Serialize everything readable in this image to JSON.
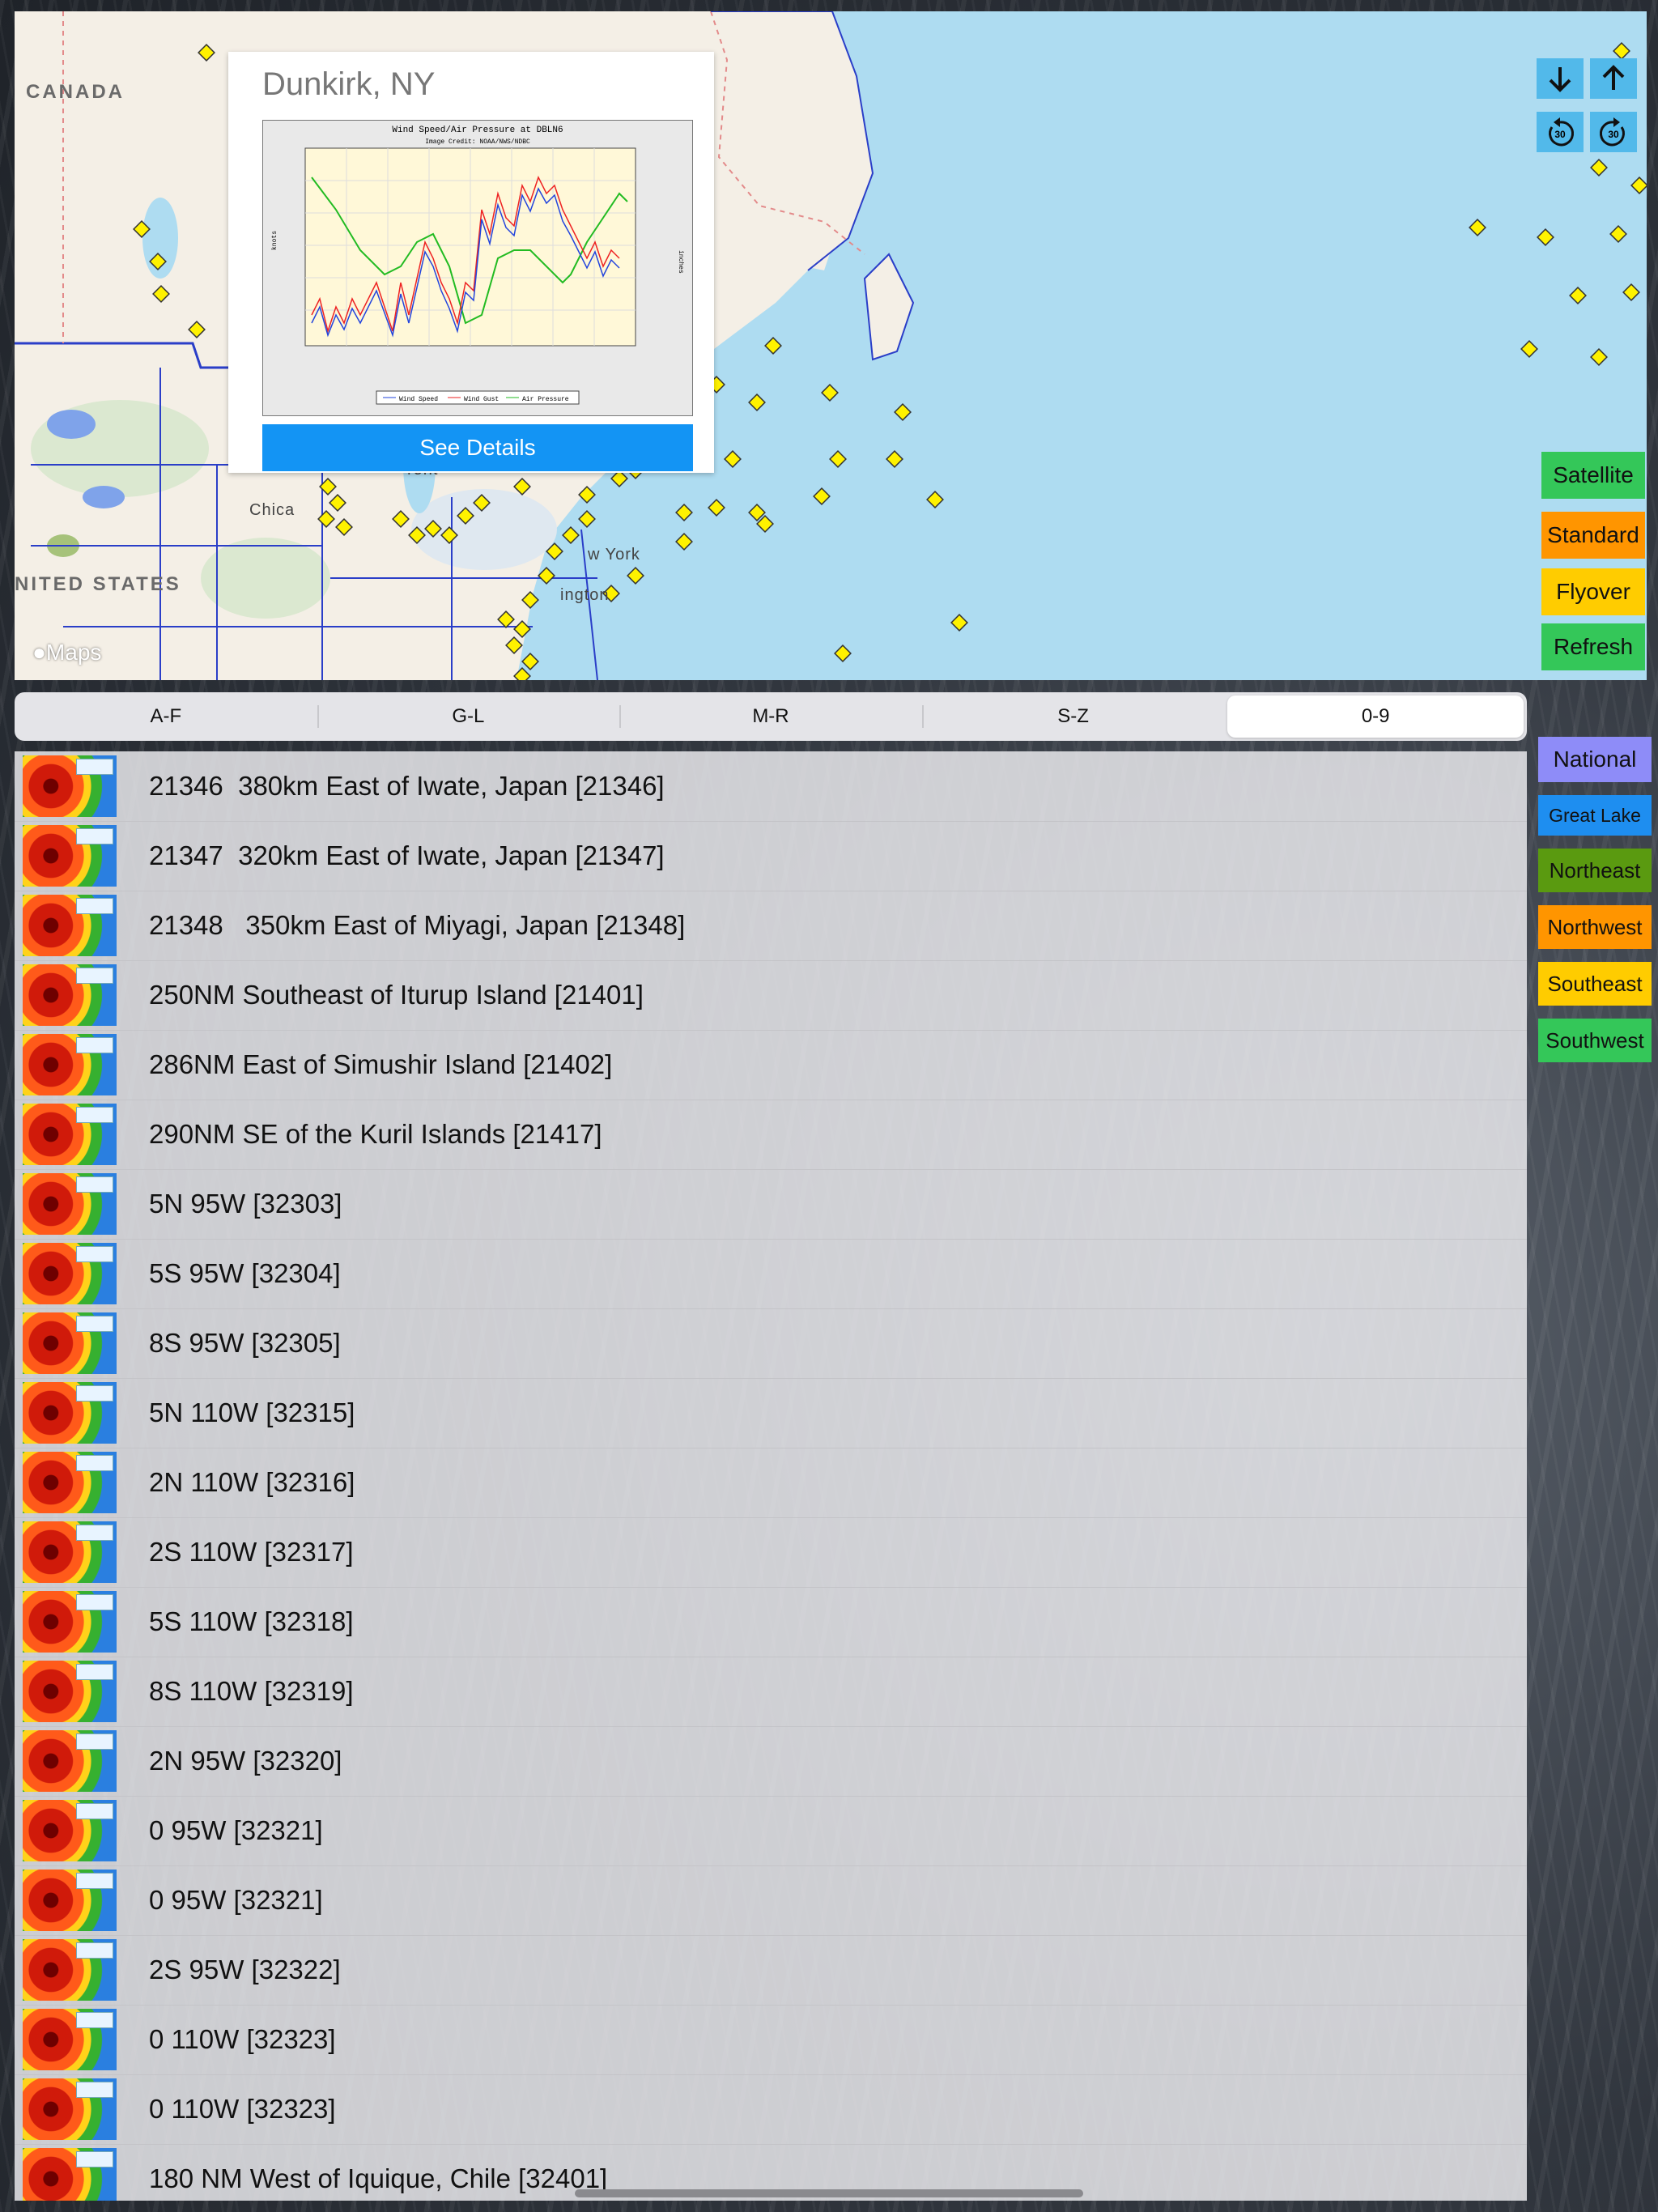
{
  "map": {
    "labels": {
      "canada": "CANADA",
      "united_states": "NITED STATES",
      "chicago": "Chica",
      "toronto": "ront",
      "new_york": "w York",
      "washington": "ington"
    },
    "attribution": "Maps",
    "popup": {
      "title": "Dunkirk, NY",
      "button_label": "See Details",
      "chart_title": "Wind Speed/Air Pressure at DBLN6",
      "chart_credit": "Image Credit: NOAA/NWS/NDBC",
      "y_label_left": "knots",
      "y_label_right": "inches",
      "legend": [
        "Wind Speed",
        "Wind Gust",
        "Air Pressure"
      ]
    },
    "nav_buttons": [
      "down-arrow",
      "up-arrow",
      "rewind-30",
      "forward-30"
    ],
    "mode_buttons": [
      {
        "label": "Satellite",
        "color": "#34c759"
      },
      {
        "label": "Standard",
        "color": "#ff9500"
      },
      {
        "label": "Flyover",
        "color": "#ffcc00"
      },
      {
        "label": "Refresh",
        "color": "#34c759"
      }
    ]
  },
  "segmented": {
    "tabs": [
      "A-F",
      "G-L",
      "M-R",
      "S-Z",
      "0-9"
    ],
    "selected": "0-9"
  },
  "regions": [
    {
      "label": "National",
      "color": "#8e8cf8"
    },
    {
      "label": "Great Lake",
      "color": "#1e8ef0"
    },
    {
      "label": "Northeast",
      "color": "#5a9a10"
    },
    {
      "label": "Northwest",
      "color": "#ff9500"
    },
    {
      "label": "Southeast",
      "color": "#ffcc00"
    },
    {
      "label": "Southwest",
      "color": "#34c759"
    }
  ],
  "stations": [
    "21346  380km East of Iwate, Japan [21346]",
    "21347  320km East of Iwate, Japan [21347]",
    "21348   350km East of Miyagi, Japan [21348]",
    "250NM Southeast of Iturup Island [21401]",
    "286NM East of Simushir Island [21402]",
    "290NM SE of the Kuril Islands [21417]",
    "5N 95W [32303]",
    "5S 95W [32304]",
    "8S 95W [32305]",
    "5N 110W [32315]",
    "2N 110W [32316]",
    "2S 110W [32317]",
    "5S 110W [32318]",
    "8S 110W [32319]",
    "2N 95W [32320]",
    "0 95W [32321]",
    "0 95W [32321]",
    "2S 95W [32322]",
    "0 110W [32323]",
    "0 110W [32323]",
    "180 NM West of Iquique, Chile [32401]"
  ]
}
